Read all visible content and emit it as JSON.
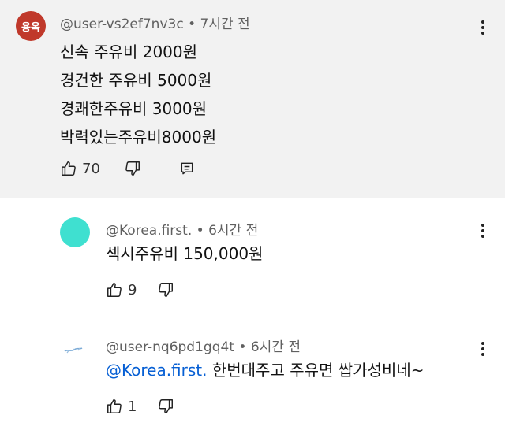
{
  "main_comment": {
    "avatar_text": "용옥",
    "author": "@user-vs2ef7nv3c",
    "separator": "•",
    "time": "7시간 전",
    "lines": [
      "신속 주유비 2000원",
      "경건한 주유비 5000원",
      "경쾌한주유비 3000원",
      "박력있는주유비8000원"
    ],
    "like_count": "70",
    "colors": {
      "background": "#f2f2f2",
      "avatar": "#c0392b"
    }
  },
  "reply1": {
    "author": "@Korea.first.",
    "separator": "•",
    "time": "6시간 전",
    "text": "섹시주유비 150,000원",
    "like_count": "9",
    "colors": {
      "avatar": "#3fe0d0"
    }
  },
  "reply2": {
    "author": "@user-nq6pd1gq4t",
    "separator": "•",
    "time": "6시간 전",
    "mention": "@Korea.first.",
    "text": " 한번대주고 주유면 쌉가성비네~",
    "like_count": "1",
    "colors": {
      "mention": "#065fd4"
    }
  },
  "icons": [
    "thumbs-up-icon",
    "thumbs-down-icon",
    "reply-icon",
    "more-vert-icon"
  ]
}
